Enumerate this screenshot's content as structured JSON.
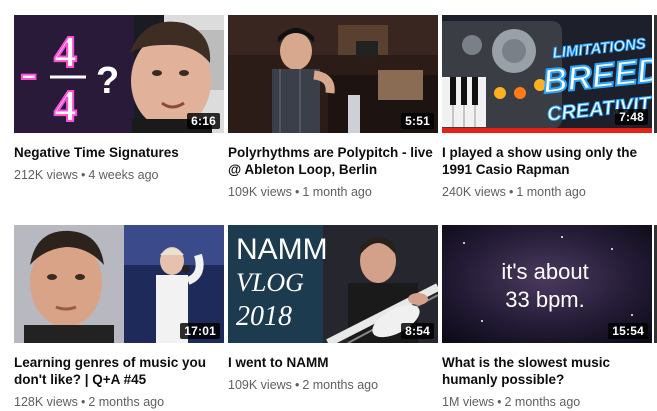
{
  "videos": [
    {
      "title": "Negative Time Signatures",
      "views": "212K views",
      "age": "4 weeks ago",
      "duration": "6:16",
      "thumb_text": "-4/4 ?"
    },
    {
      "title": "Polyrhythms are Polypitch - live @ Ableton Loop, Berlin",
      "views": "109K views",
      "age": "1 month ago",
      "duration": "5:51"
    },
    {
      "title": "I played a show using only the 1991 Casio Rapman",
      "views": "240K views",
      "age": "1 month ago",
      "duration": "7:48",
      "thumb_text": "LIMITATIONS BREED CREATIVITY"
    },
    {
      "title": "Learning genres of music you don't like? | Q+A #45",
      "views": "128K views",
      "age": "2 months ago",
      "duration": "17:01"
    },
    {
      "title": "I went to NAMM",
      "views": "109K views",
      "age": "2 months ago",
      "duration": "8:54",
      "thumb_text": "NAMM VLOG 2018"
    },
    {
      "title": "What is the slowest music humanly possible?",
      "views": "1M views",
      "age": "2 months ago",
      "duration": "15:54",
      "thumb_text": "it's about 33 bpm."
    }
  ],
  "meta_separator": "•",
  "colors": {
    "duration_bg": "#000000",
    "title": "#0d0d0d",
    "meta": "#606060",
    "progress": "#e62117"
  }
}
